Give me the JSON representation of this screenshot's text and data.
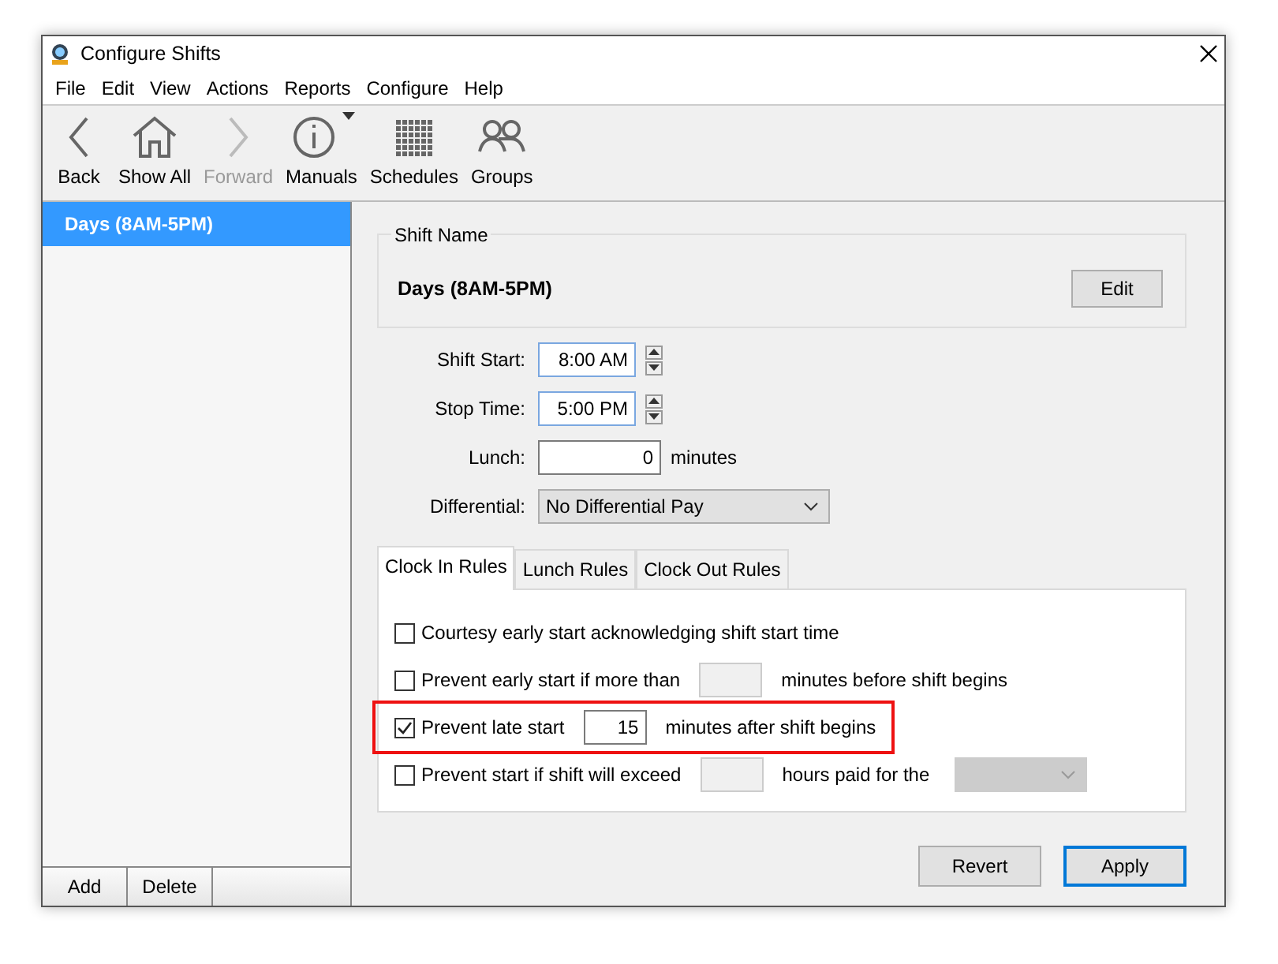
{
  "window": {
    "title": "Configure Shifts"
  },
  "menu": [
    "File",
    "Edit",
    "View",
    "Actions",
    "Reports",
    "Configure",
    "Help"
  ],
  "toolbar": [
    {
      "label": "Back",
      "disabled": false,
      "has_menu": false
    },
    {
      "label": "Show All",
      "disabled": false,
      "has_menu": false
    },
    {
      "label": "Forward",
      "disabled": true,
      "has_menu": false
    },
    {
      "label": "Manuals",
      "disabled": false,
      "has_menu": true
    },
    {
      "label": "Schedules",
      "disabled": false,
      "has_menu": false
    },
    {
      "label": "Groups",
      "disabled": false,
      "has_menu": false
    }
  ],
  "sidebar": {
    "items": [
      {
        "label": "Days (8AM-5PM)",
        "selected": true
      }
    ],
    "buttons": [
      "Add",
      "Delete"
    ]
  },
  "shift_name": {
    "legend": "Shift Name",
    "value": "Days (8AM-5PM)",
    "button": "Edit"
  },
  "fields": [
    {
      "kind": "spin",
      "label": "Shift Start:",
      "value": "8:00 AM"
    },
    {
      "kind": "spin",
      "label": "Stop Time:",
      "value": "5:00 PM"
    },
    {
      "kind": "number",
      "label": "Lunch:",
      "value": "0",
      "suffix": "minutes"
    },
    {
      "kind": "select",
      "label": "Differential:",
      "value": "No Differential Pay"
    }
  ],
  "tabs": [
    {
      "label": "Clock In Rules",
      "selected": true
    },
    {
      "label": "Lunch Rules",
      "selected": false
    },
    {
      "label": "Clock Out Rules",
      "selected": false
    }
  ],
  "rules": [
    {
      "label": "Courtesy early start acknowledging shift start time",
      "checked": false,
      "highlighted": false
    },
    {
      "label": "Prevent early start if more than",
      "checked": false,
      "highlighted": false,
      "field": {
        "disabled": true
      },
      "suffix": "minutes before shift begins"
    },
    {
      "label": "Prevent late start",
      "checked": true,
      "highlighted": true,
      "field": {
        "value": "15",
        "disabled": false
      },
      "suffix": "minutes after shift begins"
    },
    {
      "label": "Prevent start if shift will exceed",
      "checked": false,
      "highlighted": false,
      "field": {
        "disabled": true
      },
      "suffix": "hours paid for the",
      "dropdown": {
        "disabled": true
      }
    }
  ],
  "buttons": [
    {
      "label": "Revert",
      "default": false
    },
    {
      "label": "Apply",
      "default": true
    }
  ]
}
